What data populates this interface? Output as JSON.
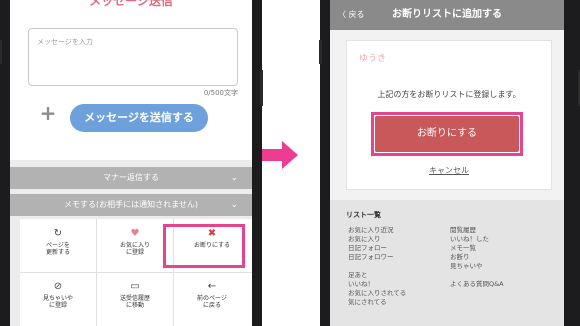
{
  "left_screen": {
    "header_title": "メッセージ送信",
    "message_placeholder": "メッセージを入力",
    "char_count": "0/500文字",
    "plus_symbol": "+",
    "send_button": "メッセージを送信する",
    "manner_bar": "マナー返信する",
    "memo_bar": "メモする(お相手には通知されません)",
    "chevron": "⌄",
    "actions": [
      {
        "icon": "refresh-icon",
        "glyph": "↻",
        "label": "ページを\n更新する",
        "color": "#444444"
      },
      {
        "icon": "heart-icon",
        "glyph": "♥",
        "label": "お気に入り\nに登録",
        "color": "#e77f95"
      },
      {
        "icon": "close-icon",
        "glyph": "✖",
        "label": "お断りにする",
        "color": "#d43b3b"
      },
      {
        "icon": "eye-off-icon",
        "glyph": "⊘",
        "label": "見ちゃいや\nに登録",
        "color": "#444444"
      },
      {
        "icon": "inbox-icon",
        "glyph": "▭",
        "label": "送受信履歴\nに移動",
        "color": "#444444"
      },
      {
        "icon": "arrow-left-icon",
        "glyph": "←",
        "label": "前のページ\nに戻る",
        "color": "#444444"
      }
    ]
  },
  "right_screen": {
    "back_label": "〈 戻る",
    "title": "お断りリストに追加する",
    "user_name": "ゆうき",
    "description": "上記の方をお断りリストに登録します。",
    "confirm_button": "お断りにする",
    "cancel_link": "キャンセル",
    "list_title": "リスト一覧",
    "list_col_a": [
      "お気に入り近況",
      "お気に入り",
      "日記フォロー",
      "日記フォロワー",
      "",
      "足あと",
      "いいね！",
      "お気に入りされてる",
      "気にされてる"
    ],
    "list_col_b": [
      "閲覧履歴",
      "いいね！した",
      "メモ一覧",
      "お断り",
      "見ちゃいや",
      "",
      "よくある質問Q&A"
    ]
  },
  "colors": {
    "highlight": "#e5458e",
    "arrow": "#ec3d92",
    "send_button": "#6ea1db",
    "confirm_button": "#c8585a"
  }
}
